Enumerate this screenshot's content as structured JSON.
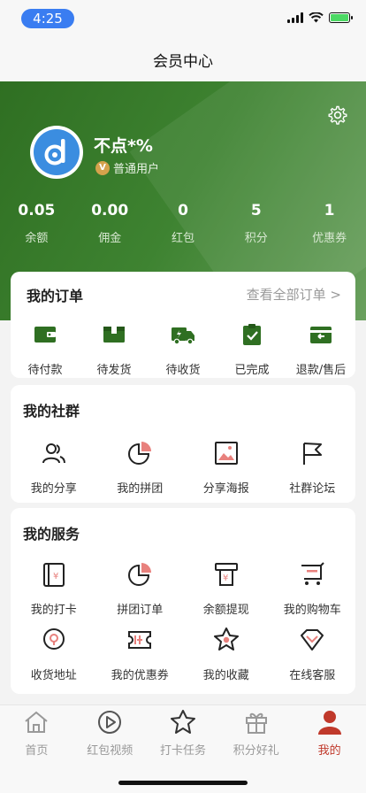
{
  "status_bar": {
    "time": "4:25"
  },
  "nav": {
    "title": "会员中心"
  },
  "profile": {
    "username": "不点*%",
    "level": "普通用户",
    "stats": [
      {
        "value": "0.05",
        "label": "余额"
      },
      {
        "value": "0.00",
        "label": "佣金"
      },
      {
        "value": "0",
        "label": "红包"
      },
      {
        "value": "5",
        "label": "积分"
      },
      {
        "value": "1",
        "label": "优惠券"
      }
    ]
  },
  "orders": {
    "title": "我的订单",
    "view_all": "查看全部订单",
    "items": [
      {
        "label": "待付款",
        "icon": "wallet-icon"
      },
      {
        "label": "待发货",
        "icon": "box-icon"
      },
      {
        "label": "待收货",
        "icon": "truck-icon"
      },
      {
        "label": "已完成",
        "icon": "clipboard-check-icon"
      },
      {
        "label": "退款/售后",
        "icon": "refund-icon"
      }
    ]
  },
  "community": {
    "title": "我的社群",
    "items": [
      {
        "label": "我的分享",
        "icon": "people-icon"
      },
      {
        "label": "我的拼团",
        "icon": "pie-icon"
      },
      {
        "label": "分享海报",
        "icon": "poster-icon"
      },
      {
        "label": "社群论坛",
        "icon": "flag-icon"
      }
    ]
  },
  "services": {
    "title": "我的服务",
    "items": [
      {
        "label": "我的打卡",
        "icon": "checkin-icon"
      },
      {
        "label": "拼团订单",
        "icon": "pie-icon"
      },
      {
        "label": "余额提现",
        "icon": "withdraw-icon"
      },
      {
        "label": "我的购物车",
        "icon": "cart-icon"
      },
      {
        "label": "收货地址",
        "icon": "location-icon"
      },
      {
        "label": "我的优惠券",
        "icon": "coupon-icon"
      },
      {
        "label": "我的收藏",
        "icon": "star-badge-icon"
      },
      {
        "label": "在线客服",
        "icon": "diamond-icon"
      }
    ]
  },
  "tabbar": {
    "tabs": [
      {
        "label": "首页",
        "icon": "home-icon"
      },
      {
        "label": "红包视频",
        "icon": "play-icon"
      },
      {
        "label": "打卡任务",
        "icon": "star-icon"
      },
      {
        "label": "积分好礼",
        "icon": "gift-icon"
      },
      {
        "label": "我的",
        "icon": "user-icon",
        "active": true
      }
    ]
  },
  "colors": {
    "brand_green": "#3e8331",
    "accent_red": "#c0392b",
    "accent_pink": "#e8817d"
  }
}
